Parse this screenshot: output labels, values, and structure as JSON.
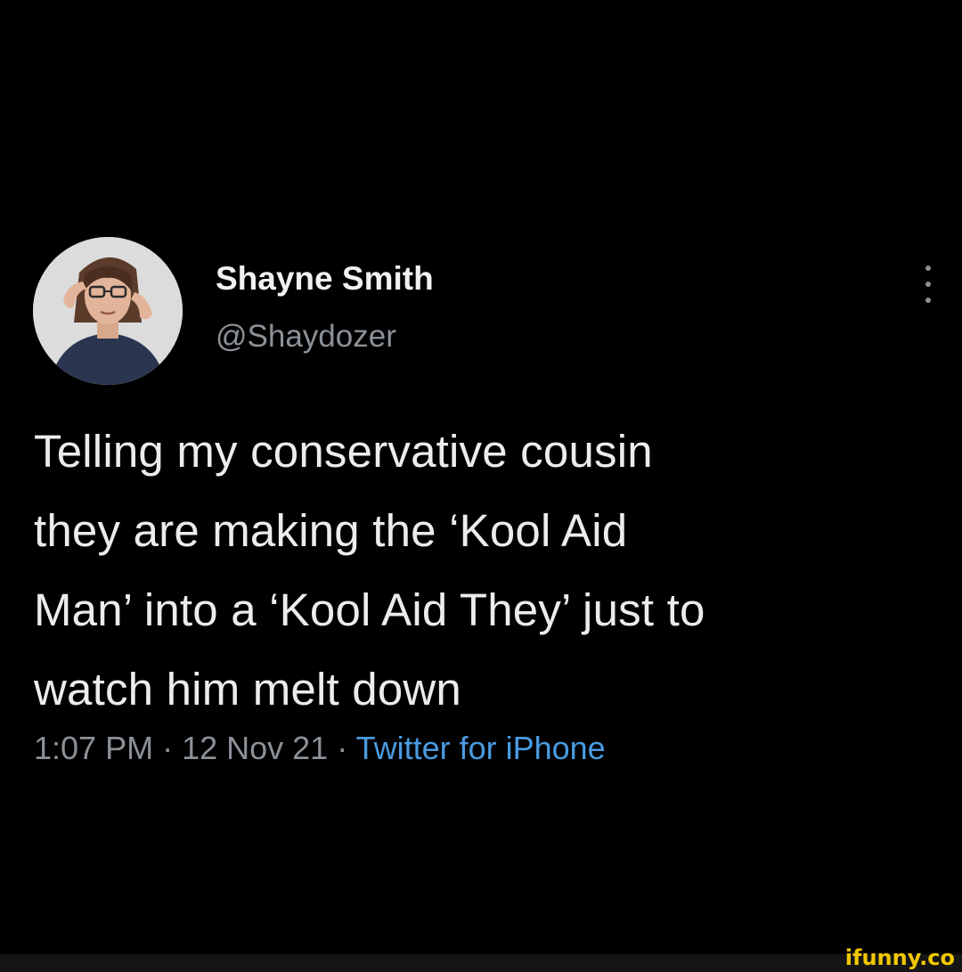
{
  "tweet": {
    "author": {
      "display_name": "Shayne Smith",
      "handle": "@Shaydozer",
      "avatar_icon": "user-photo-avatar"
    },
    "more_icon": "vertical-ellipsis-icon",
    "text_lines": [
      "Telling my conservative cousin",
      "they are making the ‘Kool Aid",
      "Man’ into a ‘Kool Aid They’ just to",
      "watch him melt down"
    ],
    "meta": {
      "time": "1:07 PM",
      "separator": "·",
      "date": "12 Nov 21",
      "source": "Twitter for iPhone"
    }
  },
  "watermark": {
    "text": "ifunny.co"
  },
  "colors": {
    "background": "#000000",
    "primary_text": "#ececec",
    "secondary_text": "#8b9197",
    "link": "#4a9be0",
    "watermark": "#f2c800"
  }
}
